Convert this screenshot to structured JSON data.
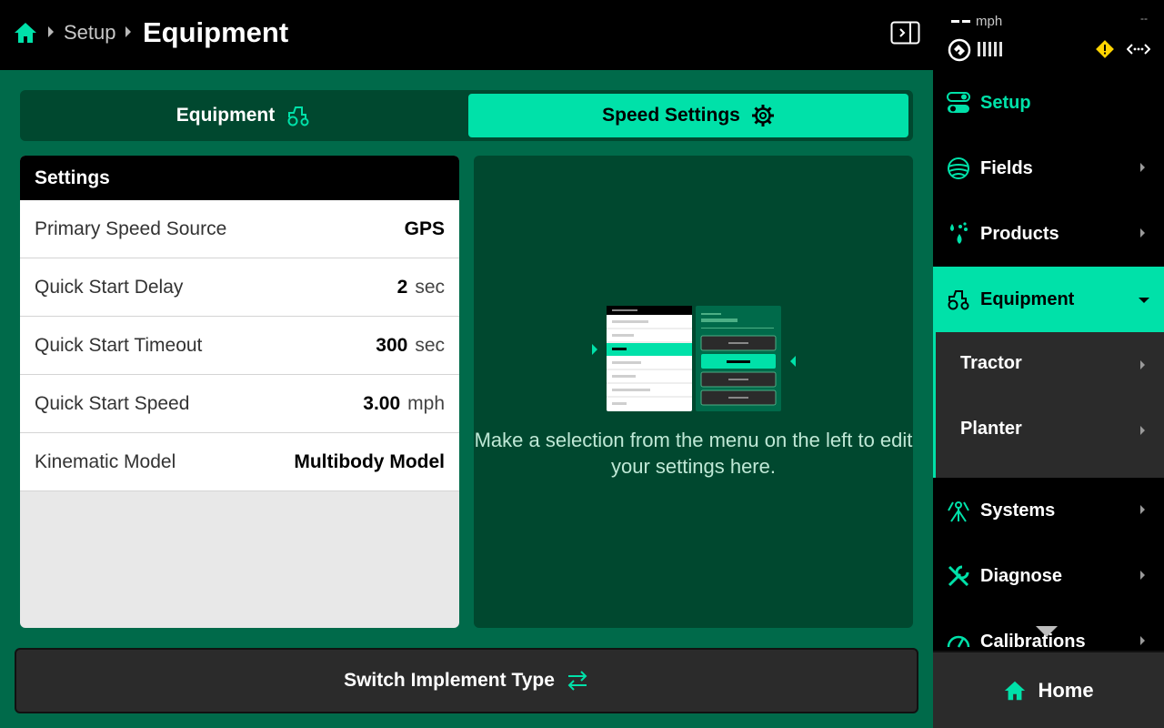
{
  "breadcrumb": {
    "parent": "Setup",
    "title": "Equipment"
  },
  "status": {
    "speed_value": "--",
    "speed_unit": "mph",
    "right_value": "--"
  },
  "tabs": [
    {
      "label": "Equipment",
      "active": false
    },
    {
      "label": "Speed Settings",
      "active": true
    }
  ],
  "settings": {
    "header": "Settings",
    "rows": [
      {
        "label": "Primary Speed Source",
        "value": "GPS",
        "unit": ""
      },
      {
        "label": "Quick Start Delay",
        "value": "2",
        "unit": "sec"
      },
      {
        "label": "Quick Start Timeout",
        "value": "300",
        "unit": "sec"
      },
      {
        "label": "Quick Start Speed",
        "value": "3.00",
        "unit": "mph"
      },
      {
        "label": "Kinematic Model",
        "value": "Multibody Model",
        "unit": ""
      }
    ]
  },
  "info": {
    "message": "Make a selection from the menu on the left to edit your settings here."
  },
  "switch_button": {
    "label": "Switch Implement Type"
  },
  "nav": {
    "items": [
      {
        "label": "Setup",
        "icon": "toggle-icon"
      },
      {
        "label": "Fields",
        "icon": "field-icon"
      },
      {
        "label": "Products",
        "icon": "drops-icon"
      },
      {
        "label": "Equipment",
        "icon": "tractor-icon"
      },
      {
        "label": "Systems",
        "icon": "systems-icon"
      },
      {
        "label": "Diagnose",
        "icon": "wrench-icon"
      },
      {
        "label": "Calibrations",
        "icon": "gauge-icon"
      }
    ],
    "sub_items": [
      {
        "label": "Tractor"
      },
      {
        "label": "Planter"
      }
    ]
  },
  "home": {
    "label": "Home"
  },
  "colors": {
    "accent": "#00e1a9",
    "background": "#006a4a",
    "panel_dark": "#00482f",
    "warning": "#ffd400"
  }
}
